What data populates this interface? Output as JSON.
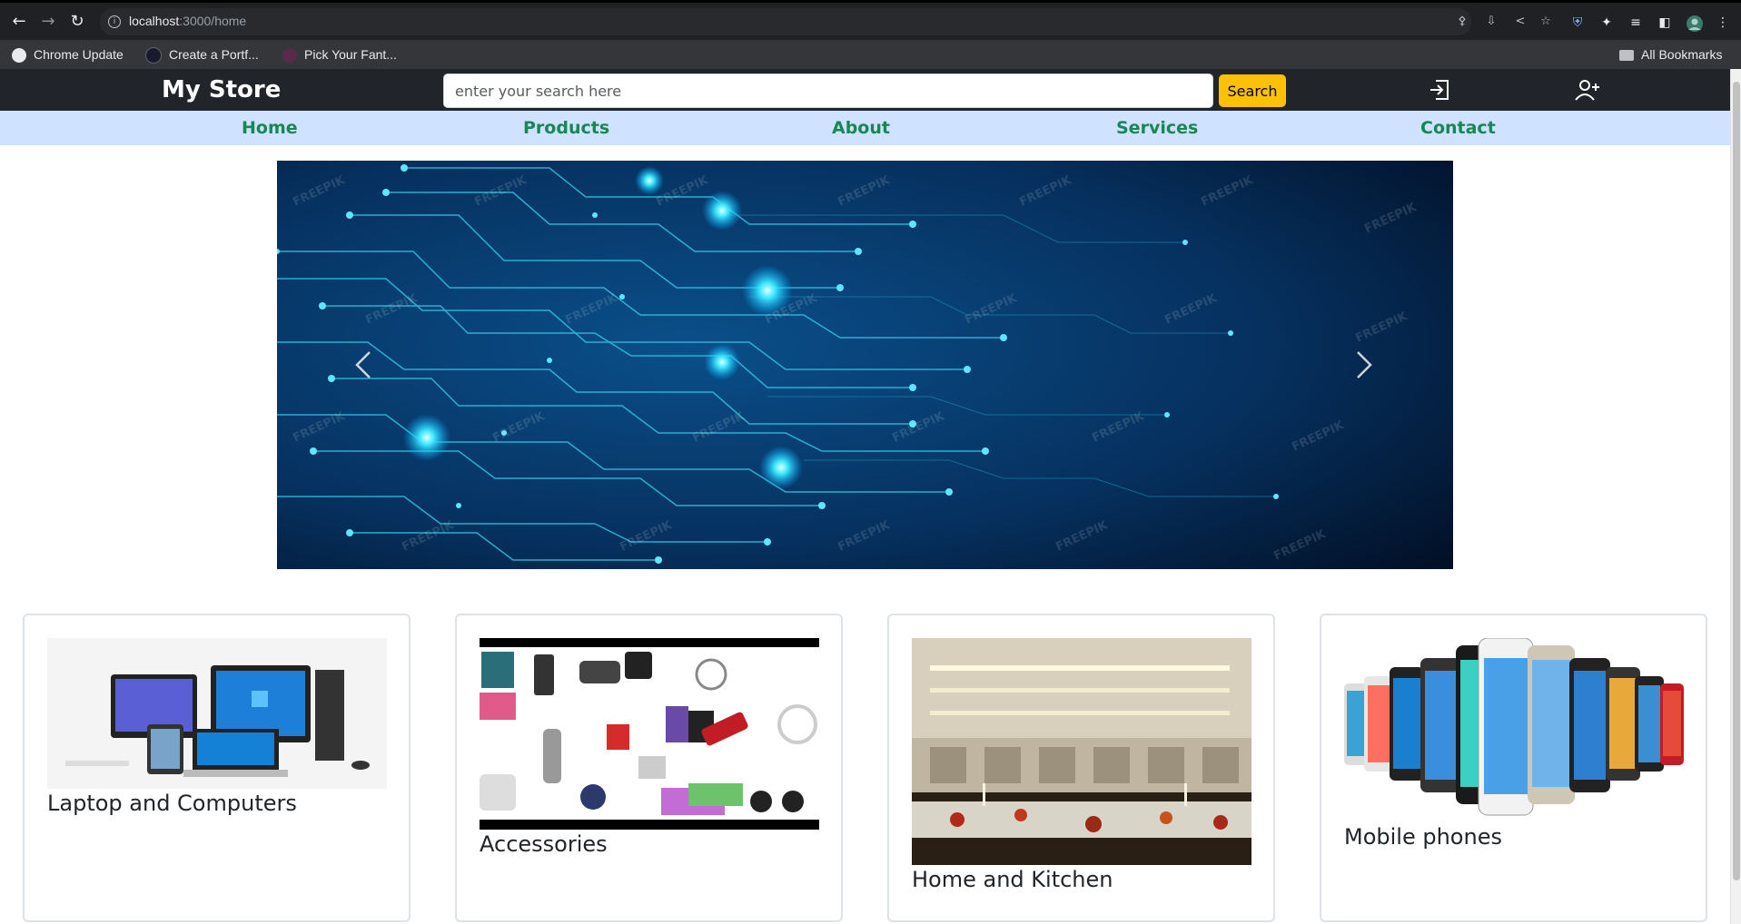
{
  "browser": {
    "url_host": "localhost",
    "url_path": ":3000/home",
    "bookmarks": [
      {
        "label": "Chrome Update",
        "icon": "github-icon"
      },
      {
        "label": "Create a Portf...",
        "icon": "angular-icon"
      },
      {
        "label": "Pick Your Fant...",
        "icon": "site-icon"
      }
    ],
    "all_bookmarks": "All Bookmarks"
  },
  "header": {
    "brand": "My Store",
    "search_placeholder": "enter your search here",
    "search_button": "Search",
    "login_icon": "login-icon",
    "signup_icon": "add-user-icon"
  },
  "nav": {
    "items": [
      "Home",
      "Products",
      "About",
      "Services",
      "Contact"
    ]
  },
  "carousel": {
    "watermark": "FREEPIK",
    "prev_icon": "chevron-left-icon",
    "next_icon": "chevron-right-icon"
  },
  "categories": [
    {
      "title": "Laptop and Computers",
      "image": "computers-image"
    },
    {
      "title": "Accessories",
      "image": "accessories-image"
    },
    {
      "title": "Home and Kitchen",
      "image": "kitchen-image"
    },
    {
      "title": "Mobile phones",
      "image": "phones-image"
    }
  ],
  "colors": {
    "header_bg": "#212529",
    "nav_bg": "#cfe2ff",
    "nav_link": "#198754",
    "search_button": "#ffc107"
  }
}
